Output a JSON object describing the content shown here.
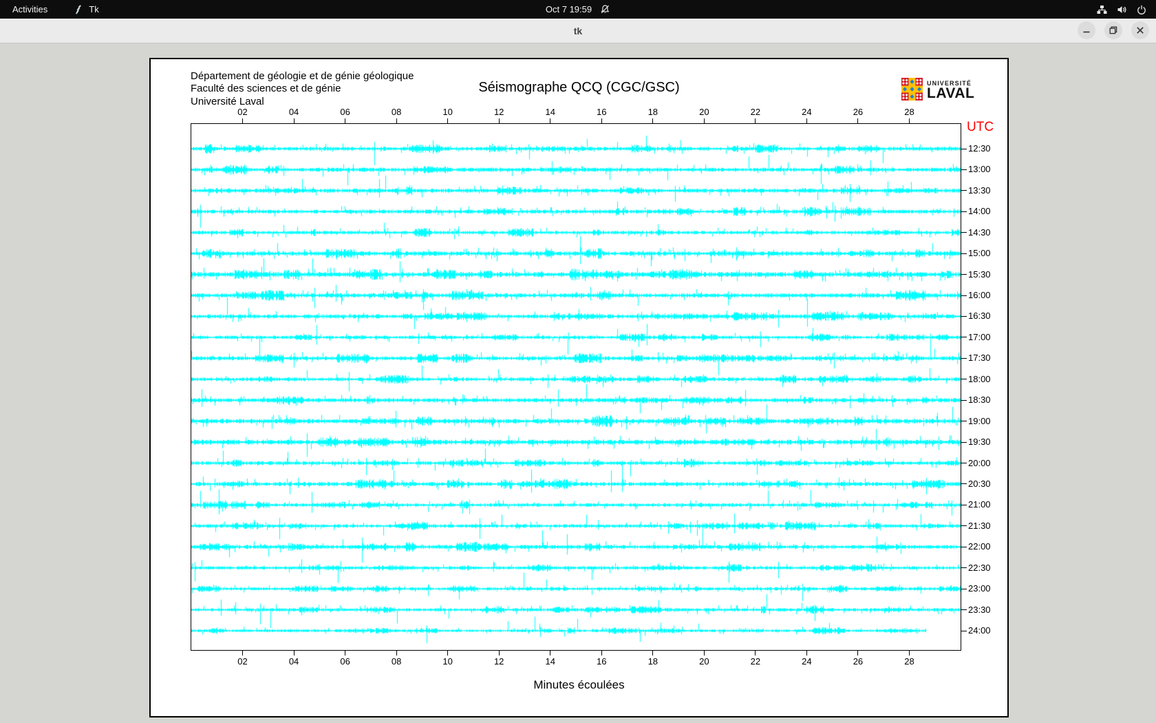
{
  "topbar": {
    "activities_label": "Activities",
    "app_name": "Tk",
    "clock": "Oct 7 19:59",
    "icons": [
      "tk-icon",
      "notifications-disabled-icon",
      "network-icon",
      "volume-icon",
      "power-icon"
    ]
  },
  "titlebar": {
    "title": "tk",
    "buttons": [
      "minimize",
      "restore",
      "close"
    ]
  },
  "header": {
    "address_lines": [
      "Département de géologie et de génie géologique",
      "Faculté des sciences et de génie",
      "Université Laval"
    ],
    "logo": {
      "top": "UNIVERSITÉ",
      "bottom": "LAVAL"
    },
    "logo_colors": {
      "red": "#d21f2c",
      "yellow": "#ffc107",
      "blue": "#1f7fd0",
      "white": "#ffffff"
    }
  },
  "chart_data": {
    "type": "line",
    "subtype": "helicorder_seismogram",
    "title": "Séismographe QCQ (CGC/GSC)",
    "xlabel": "Minutes écoulées",
    "x_axis": {
      "ticks": [
        "02",
        "04",
        "06",
        "08",
        "10",
        "12",
        "14",
        "16",
        "18",
        "20",
        "22",
        "24",
        "26",
        "28"
      ],
      "range_minutes": [
        0,
        30
      ],
      "shown_top_and_bottom": true
    },
    "right_axis": {
      "label": "UTC",
      "color": "#ff0000"
    },
    "trace_color": "#00ffff",
    "grid": false,
    "rows": [
      {
        "label": "12:30",
        "amp": 2.1,
        "width_frac": 1
      },
      {
        "label": "13:00",
        "amp": 2.2,
        "width_frac": 1
      },
      {
        "label": "13:30",
        "amp": 2.2,
        "width_frac": 1
      },
      {
        "label": "14:00",
        "amp": 2.1,
        "width_frac": 1
      },
      {
        "label": "14:30",
        "amp": 1.9,
        "width_frac": 1
      },
      {
        "label": "15:00",
        "amp": 2.4,
        "width_frac": 1
      },
      {
        "label": "15:30",
        "amp": 2.7,
        "width_frac": 1
      },
      {
        "label": "16:00",
        "amp": 2.4,
        "width_frac": 1
      },
      {
        "label": "16:30",
        "amp": 2.2,
        "width_frac": 1
      },
      {
        "label": "17:00",
        "amp": 1.9,
        "width_frac": 1
      },
      {
        "label": "17:30",
        "amp": 2.2,
        "width_frac": 1
      },
      {
        "label": "18:00",
        "amp": 2.0,
        "width_frac": 1
      },
      {
        "label": "18:30",
        "amp": 2.2,
        "width_frac": 1
      },
      {
        "label": "19:00",
        "amp": 2.5,
        "width_frac": 1
      },
      {
        "label": "19:30",
        "amp": 2.7,
        "width_frac": 1
      },
      {
        "label": "20:00",
        "amp": 2.0,
        "width_frac": 1
      },
      {
        "label": "20:30",
        "amp": 2.2,
        "width_frac": 1
      },
      {
        "label": "21:00",
        "amp": 1.9,
        "width_frac": 1
      },
      {
        "label": "21:30",
        "amp": 1.9,
        "width_frac": 1
      },
      {
        "label": "22:00",
        "amp": 2.2,
        "width_frac": 1
      },
      {
        "label": "22:30",
        "amp": 1.8,
        "width_frac": 1
      },
      {
        "label": "23:00",
        "amp": 1.7,
        "width_frac": 1
      },
      {
        "label": "23:30",
        "amp": 1.8,
        "width_frac": 1
      },
      {
        "label": "24:00",
        "amp": 1.5,
        "width_frac": 0.955
      }
    ]
  }
}
